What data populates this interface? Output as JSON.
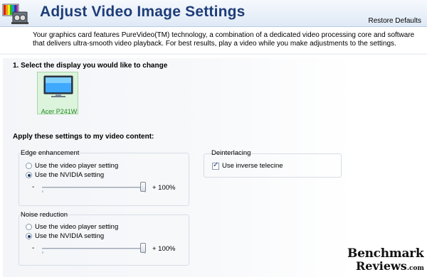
{
  "header": {
    "title": "Adjust Video Image Settings",
    "restore_label": "Restore Defaults"
  },
  "description": "Your graphics card features PureVideo(TM) technology, a combination of a dedicated video processing core and software that delivers ultra-smooth video playback. For best results, play a video while you make adjustments to the settings.",
  "section1": {
    "title": "1. Select the display you would like to change",
    "display": {
      "name": "Acer P241W",
      "selected": true
    }
  },
  "apply": {
    "title": "Apply these settings to my video content:",
    "edge": {
      "label": "Edge enhancement",
      "option_player": "Use the video player setting",
      "option_nvidia": "Use the NVIDIA setting",
      "selected": "nvidia",
      "minus": "-",
      "value": "+ 100%",
      "level": 1.0
    },
    "deinterlacing": {
      "label": "Deinterlacing",
      "option": "Use inverse telecine",
      "checked": true
    },
    "noise": {
      "label": "Noise reduction",
      "option_player": "Use the video player setting",
      "option_nvidia": "Use the NVIDIA setting",
      "selected": "nvidia",
      "minus": "-",
      "value": "+ 100%",
      "level": 1.0
    }
  },
  "watermark": {
    "line1": "Benchmark",
    "line2": "Reviews",
    "suffix": ".com"
  },
  "colors": {
    "title": "#1e3d78",
    "display_tile": "#dcf3dc",
    "display_label": "#2a8a2a"
  }
}
